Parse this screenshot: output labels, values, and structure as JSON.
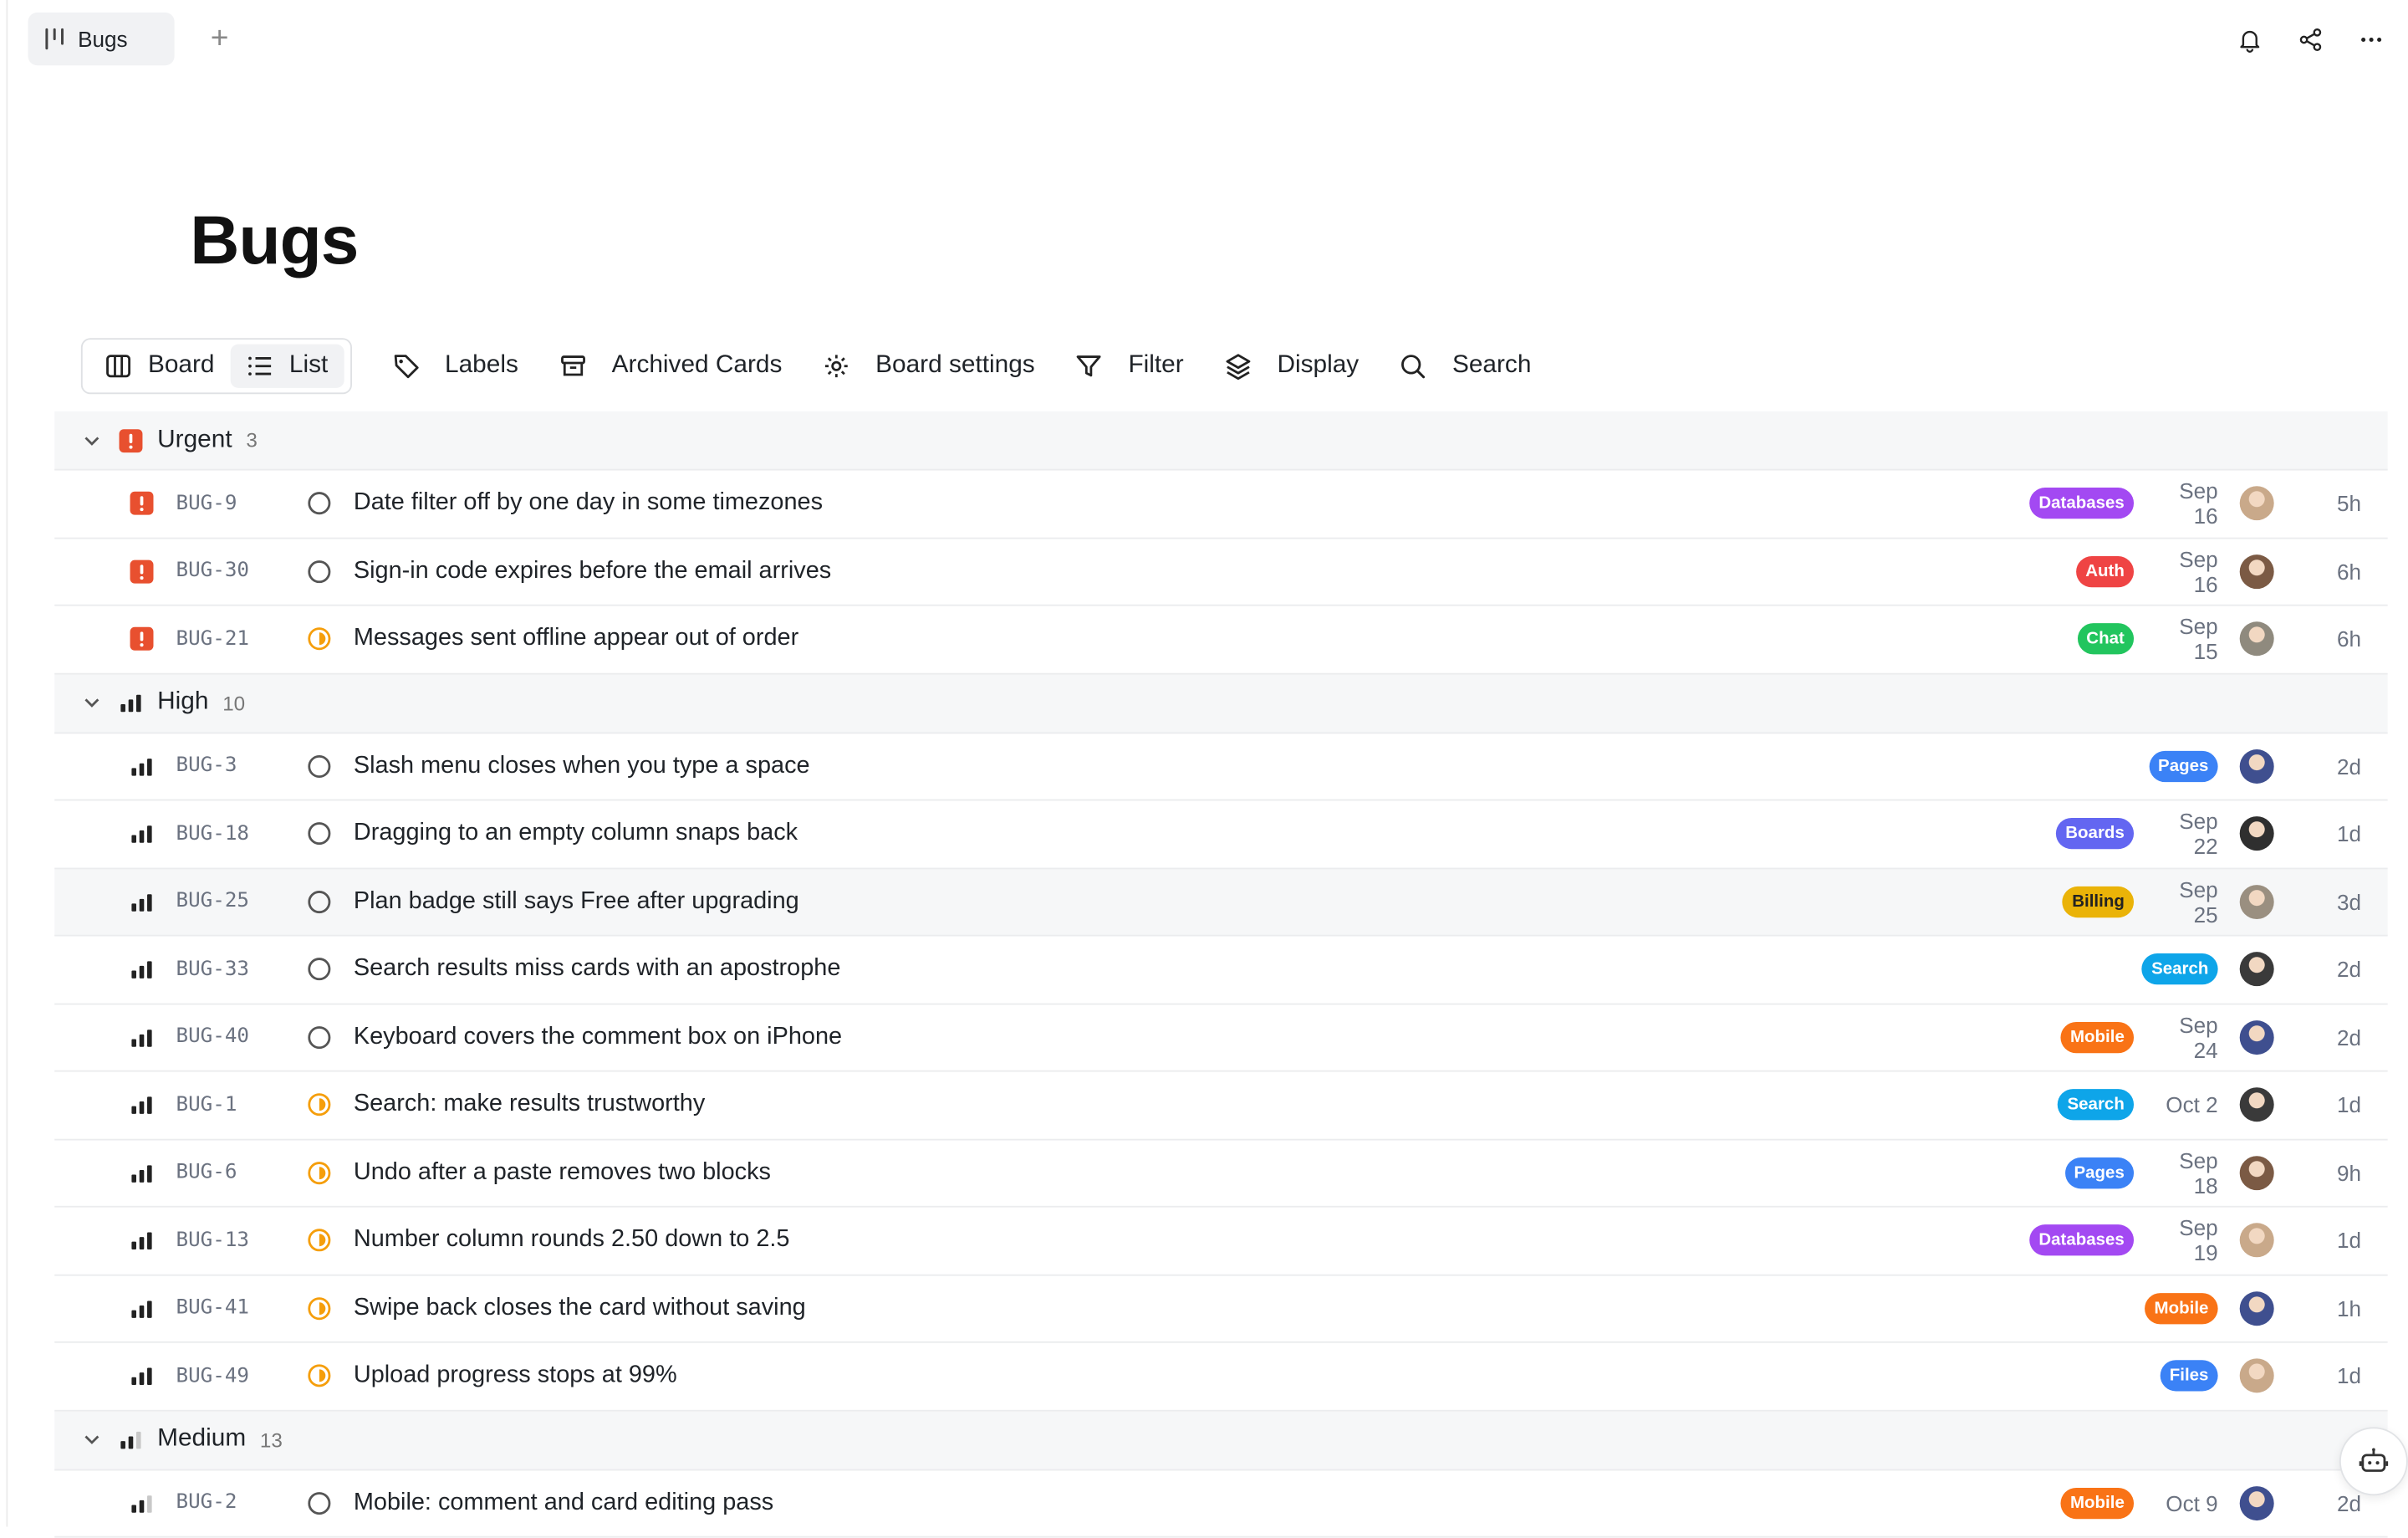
{
  "tab": {
    "title": "Bugs",
    "add_symbol": "+"
  },
  "page": {
    "title": "Bugs"
  },
  "toolbar": {
    "board": "Board",
    "list": "List",
    "labels": "Labels",
    "archived": "Archived Cards",
    "settings": "Board settings",
    "filter": "Filter",
    "display": "Display",
    "search": "Search"
  },
  "colors": {
    "urgent": "#e8502f",
    "progress": "#f59e0b",
    "Databases": "#a349f2",
    "Auth": "#ef4444",
    "Chat": "#22c55e",
    "Pages": "#3b82f6",
    "Boards": "#6366f1",
    "Billing": "#eab308",
    "Search": "#0ea5e9",
    "Mobile": "#f97316",
    "Files": "#3b82f6"
  },
  "groups": [
    {
      "name": "Urgent",
      "count": "3",
      "priority": "urgent",
      "rows": [
        {
          "id": "BUG-9",
          "title": "Date filter off by one day in some timezones",
          "status": "todo",
          "label": "Databases",
          "date": "Sep 16",
          "avatar": "#c9a98a",
          "age": "5h"
        },
        {
          "id": "BUG-30",
          "title": "Sign-in code expires before the email arrives",
          "status": "todo",
          "label": "Auth",
          "date": "Sep 16",
          "avatar": "#7b5a44",
          "age": "6h"
        },
        {
          "id": "BUG-21",
          "title": "Messages sent offline appear out of order",
          "status": "progress",
          "label": "Chat",
          "date": "Sep 15",
          "avatar": "#8f8a7e",
          "age": "6h"
        }
      ]
    },
    {
      "name": "High",
      "count": "10",
      "priority": "high",
      "rows": [
        {
          "id": "BUG-3",
          "title": "Slash menu closes when you type a space",
          "status": "todo",
          "label": "Pages",
          "date": "",
          "avatar": "#3f4f8f",
          "age": "2d"
        },
        {
          "id": "BUG-18",
          "title": "Dragging to an empty column snaps back",
          "status": "todo",
          "label": "Boards",
          "date": "Sep 22",
          "avatar": "#2f2f2f",
          "age": "1d"
        },
        {
          "id": "BUG-25",
          "title": "Plan badge still says Free after upgrading",
          "status": "todo",
          "label": "Billing",
          "date": "Sep 25",
          "avatar": "#9a8f80",
          "age": "3d",
          "alt": true
        },
        {
          "id": "BUG-33",
          "title": "Search results miss cards with an apostrophe",
          "status": "todo",
          "label": "Search",
          "date": "",
          "avatar": "#3a3a3a",
          "age": "2d"
        },
        {
          "id": "BUG-40",
          "title": "Keyboard covers the comment box on iPhone",
          "status": "todo",
          "label": "Mobile",
          "date": "Sep 24",
          "avatar": "#3f4f8f",
          "age": "2d"
        },
        {
          "id": "BUG-1",
          "title": "Search: make results trustworthy",
          "status": "progress",
          "label": "Search",
          "date": "Oct 2",
          "avatar": "#3a3a3a",
          "age": "1d"
        },
        {
          "id": "BUG-6",
          "title": "Undo after a paste removes two blocks",
          "status": "progress",
          "label": "Pages",
          "date": "Sep 18",
          "avatar": "#7b5a44",
          "age": "9h"
        },
        {
          "id": "BUG-13",
          "title": "Number column rounds 2.50 down to 2.5",
          "status": "progress",
          "label": "Databases",
          "date": "Sep 19",
          "avatar": "#c9a98a",
          "age": "1d"
        },
        {
          "id": "BUG-41",
          "title": "Swipe back closes the card without saving",
          "status": "progress",
          "label": "Mobile",
          "date": "",
          "avatar": "#3f4f8f",
          "age": "1h"
        },
        {
          "id": "BUG-49",
          "title": "Upload progress stops at 99%",
          "status": "progress",
          "label": "Files",
          "date": "",
          "avatar": "#c9a98a",
          "age": "1d"
        }
      ]
    },
    {
      "name": "Medium",
      "count": "13",
      "priority": "medium",
      "rows": [
        {
          "id": "BUG-2",
          "title": "Mobile: comment and card editing pass",
          "status": "todo",
          "label": "Mobile",
          "date": "Oct 9",
          "avatar": "#3f4f8f",
          "age": "2d"
        }
      ]
    }
  ]
}
